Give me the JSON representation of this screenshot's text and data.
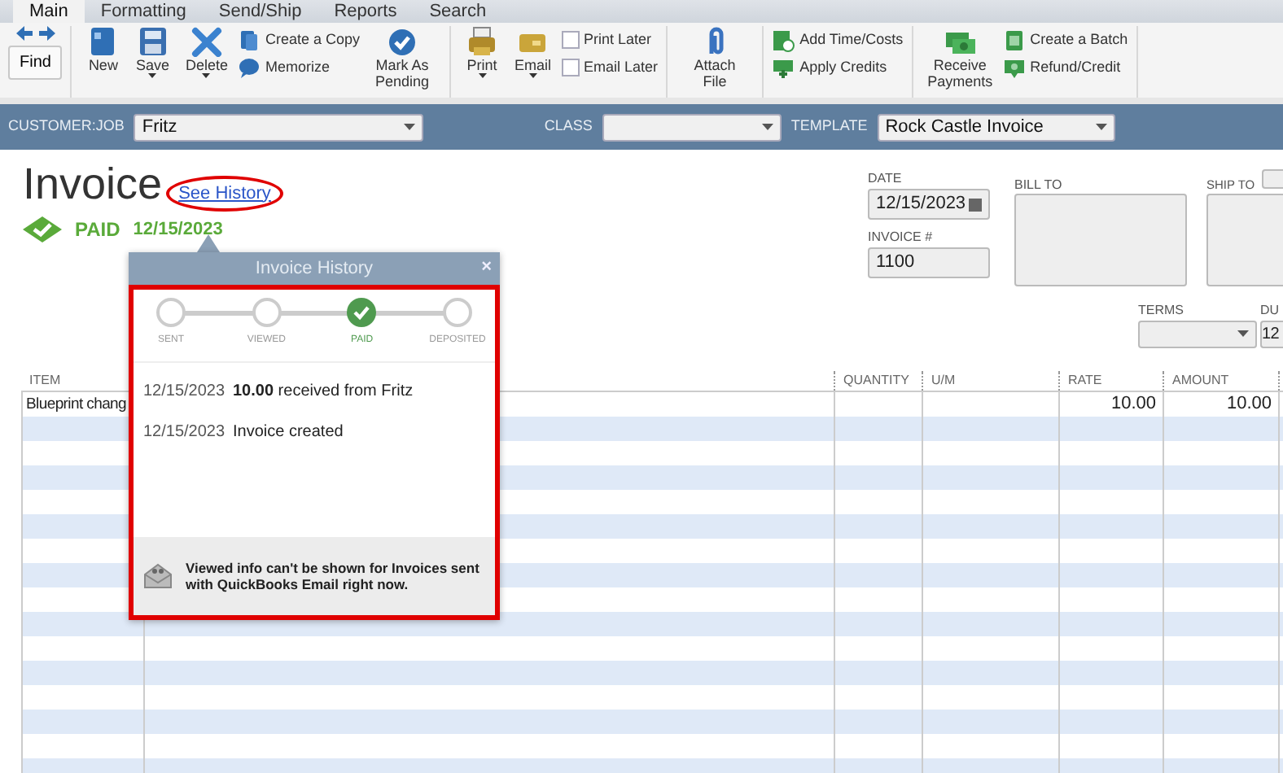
{
  "tabs": [
    {
      "label": "Main",
      "selected": true
    },
    {
      "label": "Formatting",
      "selected": false
    },
    {
      "label": "Send/Ship",
      "selected": false
    },
    {
      "label": "Reports",
      "selected": false
    },
    {
      "label": "Search",
      "selected": false
    }
  ],
  "toolbar": [
    [
      {
        "kind": "find",
        "label": "Find"
      }
    ],
    [
      {
        "kind": "big",
        "label": "New",
        "dropdown": false
      },
      {
        "kind": "big",
        "label": "Save",
        "dropdown": true
      },
      {
        "kind": "big",
        "label": "Delete",
        "dropdown": true
      },
      {
        "kind": "stack",
        "items": [
          {
            "kind": "small",
            "label": "Create a Copy"
          },
          {
            "kind": "small",
            "label": "Memorize"
          }
        ]
      },
      {
        "kind": "big",
        "label": "Mark As Pending",
        "dropdown": false
      }
    ],
    [
      {
        "kind": "big",
        "label": "Print",
        "dropdown": true
      },
      {
        "kind": "big",
        "label": "Email",
        "dropdown": true
      },
      {
        "kind": "stack",
        "items": [
          {
            "kind": "check",
            "label": "Print Later",
            "checked": false
          },
          {
            "kind": "check",
            "label": "Email Later",
            "checked": false
          }
        ]
      }
    ],
    [
      {
        "kind": "big",
        "label": "Attach File",
        "dropdown": false
      }
    ],
    [
      {
        "kind": "stack",
        "items": [
          {
            "kind": "small",
            "label": "Add Time/Costs"
          },
          {
            "kind": "small",
            "label": "Apply Credits"
          }
        ]
      }
    ],
    [
      {
        "kind": "big",
        "label": "Receive Payments",
        "dropdown": false
      },
      {
        "kind": "stack",
        "items": [
          {
            "kind": "small",
            "label": "Create a Batch"
          },
          {
            "kind": "small",
            "label": "Refund/Credit"
          }
        ]
      }
    ]
  ],
  "header_bar": {
    "customer_job": {
      "label": "CUSTOMER:JOB",
      "value": "Fritz"
    },
    "class": {
      "label": "CLASS"
    },
    "template": {
      "label": "TEMPLATE",
      "value": "Rock Castle Invoice"
    }
  },
  "form": {
    "title": "Invoice",
    "history_link": "See History",
    "status": {
      "label": "PAID",
      "date": "12/15/2023"
    },
    "date": {
      "label": "DATE",
      "value": "12/15/2023"
    },
    "invoice_no": {
      "label": "INVOICE #",
      "value": "1100"
    },
    "bill_to": {
      "label": "BILL TO"
    },
    "ship_to": {
      "label": "SHIP TO"
    },
    "terms": {
      "label": "TERMS"
    },
    "due": {
      "label": "DU",
      "value": "12"
    }
  },
  "table": {
    "columns": [
      "ITEM",
      "QUANTITY",
      "U/M",
      "RATE",
      "AMOUNT"
    ],
    "rows": [
      {
        "item": "Blueprint chang",
        "rate": "10.00",
        "amount": "10.00"
      }
    ]
  },
  "history_popup": {
    "title": "Invoice History",
    "close": "×",
    "steps": [
      {
        "label": "SENT",
        "done": false
      },
      {
        "label": "VIEWED",
        "done": false
      },
      {
        "label": "PAID",
        "done": true
      },
      {
        "label": "DEPOSITED",
        "done": false
      }
    ],
    "events": [
      {
        "date": "12/15/2023",
        "text": "**10.00** received from Fritz"
      },
      {
        "date": "12/15/2023",
        "text": "Invoice created"
      }
    ],
    "note": "**Viewed** info can't be shown for Invoices sent with QuickBooks Email right now."
  }
}
